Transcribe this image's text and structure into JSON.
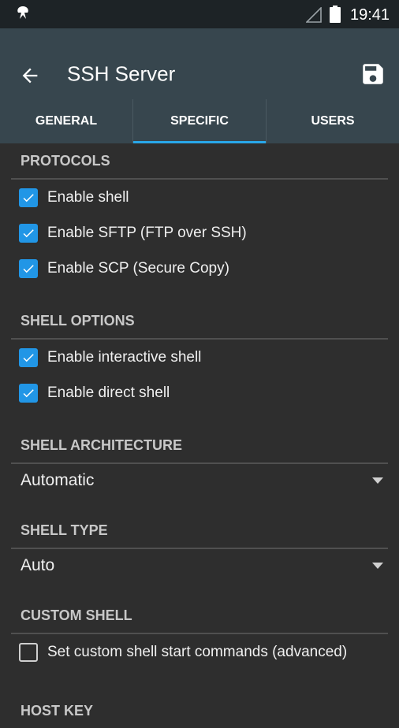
{
  "status_bar": {
    "time": "19:41",
    "icons": [
      "app-icon",
      "signal-icon",
      "battery-icon"
    ]
  },
  "toolbar": {
    "title": "SSH Server",
    "back_icon": "arrow-left-icon",
    "save_icon": "floppy-save-icon"
  },
  "tabs": [
    {
      "label": "GENERAL",
      "active": false
    },
    {
      "label": "SPECIFIC",
      "active": true
    },
    {
      "label": "USERS",
      "active": false
    }
  ],
  "colors": {
    "accent": "#29a7e9",
    "checkbox": "#2196e6",
    "toolbar": "#37464e",
    "background": "#2e2e2e"
  },
  "sections": {
    "protocols": {
      "header": "PROTOCOLS",
      "items": [
        {
          "label": "Enable shell",
          "checked": true
        },
        {
          "label": "Enable SFTP (FTP over SSH)",
          "checked": true
        },
        {
          "label": "Enable SCP (Secure Copy)",
          "checked": true
        }
      ]
    },
    "shell_options": {
      "header": "SHELL OPTIONS",
      "items": [
        {
          "label": "Enable interactive shell",
          "checked": true
        },
        {
          "label": "Enable direct shell",
          "checked": true
        }
      ]
    },
    "shell_architecture": {
      "header": "SHELL ARCHITECTURE",
      "value": "Automatic"
    },
    "shell_type": {
      "header": "SHELL TYPE",
      "value": "Auto"
    },
    "custom_shell": {
      "header": "CUSTOM SHELL",
      "items": [
        {
          "label": "Set custom shell start commands (advanced)",
          "checked": false
        }
      ]
    },
    "host_key": {
      "header": "HOST KEY"
    }
  }
}
